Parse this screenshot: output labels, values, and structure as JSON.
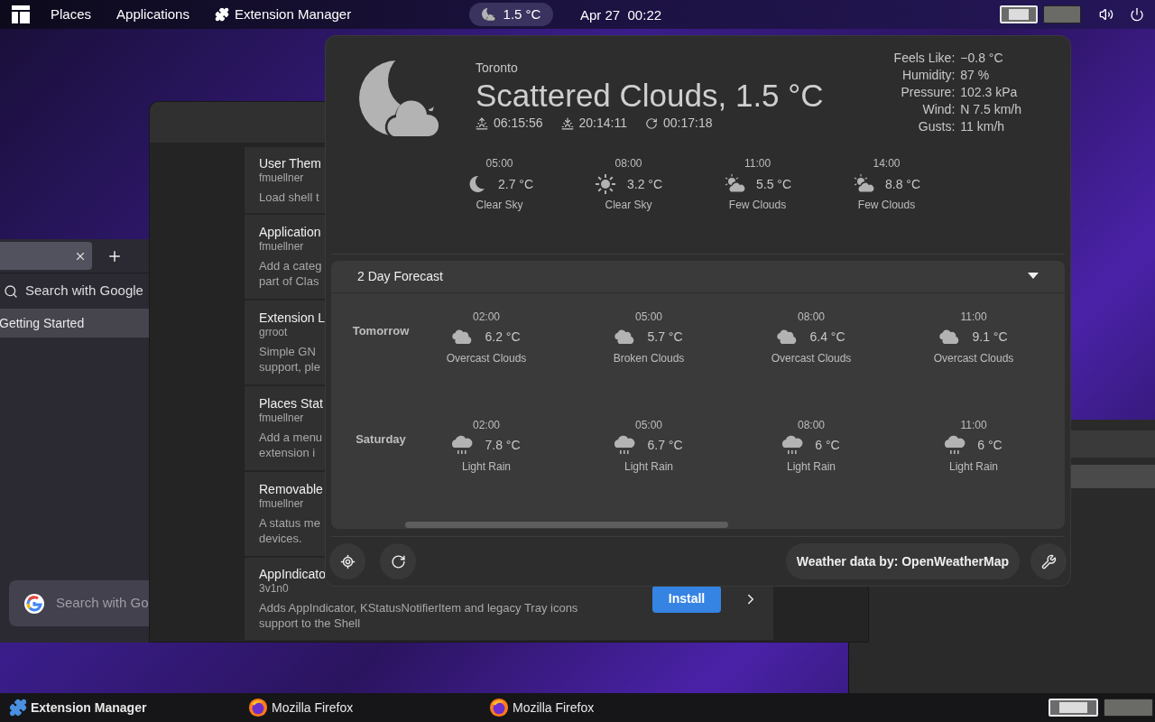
{
  "top_bar": {
    "menus": [
      "Places",
      "Applications"
    ],
    "app": "Extension Manager",
    "weather": "1.5 °C",
    "clock": "Apr 27  00:22",
    "workspaces": [
      {
        "selected": true
      },
      {
        "selected": false
      }
    ]
  },
  "firefox": {
    "search_placeholder": "Search with Google",
    "bookmark": "Getting Started",
    "page_search_placeholder": "Search with Go"
  },
  "extension_manager": {
    "extensions": [
      {
        "name": "User Them",
        "author": "fmuellner",
        "description": [
          "Load shell t"
        ]
      },
      {
        "name": "Application",
        "author": "fmuellner",
        "description": [
          "Add a categ",
          "part of Clas"
        ]
      },
      {
        "name": "Extension L",
        "author": "grroot",
        "description": [
          "Simple GN",
          "support, ple"
        ]
      },
      {
        "name": "Places Stat",
        "author": "fmuellner",
        "description": [
          "Add a menu",
          "extension i"
        ]
      },
      {
        "name": "Removable",
        "author": "fmuellner",
        "description": [
          "A status me",
          "devices."
        ]
      },
      {
        "name": "AppIndicato",
        "author": "3v1n0",
        "description": [
          "Adds AppIndicator, KStatusNotifierItem and legacy Tray icons",
          "support to the Shell"
        ],
        "action": "Install"
      }
    ]
  },
  "weather": {
    "kind": "night_clouds",
    "location": "Toronto",
    "summary": "Scattered Clouds, 1.5 °C",
    "sunrise": "06:15:56",
    "sunset": "20:14:11",
    "updated": "00:17:18",
    "details": [
      {
        "label": "Feels Like:",
        "value": "−0.8 °C"
      },
      {
        "label": "Humidity:",
        "value": "87 %"
      },
      {
        "label": "Pressure:",
        "value": "102.3 kPa"
      },
      {
        "label": "Wind:",
        "value": "N 7.5 km/h"
      },
      {
        "label": "Gusts:",
        "value": "11 km/h"
      }
    ],
    "today": [
      {
        "time": "05:00",
        "kind": "moon",
        "temp": "2.7 °C",
        "condition": "Clear Sky"
      },
      {
        "time": "08:00",
        "kind": "sun",
        "temp": "3.2 °C",
        "condition": "Clear Sky"
      },
      {
        "time": "11:00",
        "kind": "few_clouds",
        "temp": "5.5 °C",
        "condition": "Few Clouds"
      },
      {
        "time": "14:00",
        "kind": "few_clouds",
        "temp": "8.8 °C",
        "condition": "Few Clouds"
      }
    ],
    "forecast": {
      "title": "2 Day Forecast",
      "expanded": true,
      "days": [
        {
          "label": "Tomorrow",
          "hours": [
            {
              "time": "02:00",
              "kind": "overcast",
              "temp": "6.2 °C",
              "condition": "Overcast Clouds"
            },
            {
              "time": "05:00",
              "kind": "overcast",
              "temp": "5.7 °C",
              "condition": "Broken Clouds"
            },
            {
              "time": "08:00",
              "kind": "overcast",
              "temp": "6.4 °C",
              "condition": "Overcast Clouds"
            },
            {
              "time": "11:00",
              "kind": "overcast",
              "temp": "9.1 °C",
              "condition": "Overcast Clouds"
            }
          ]
        },
        {
          "label": "Saturday",
          "hours": [
            {
              "time": "02:00",
              "kind": "rain",
              "temp": "7.8 °C",
              "condition": "Light Rain"
            },
            {
              "time": "05:00",
              "kind": "rain",
              "temp": "6.7 °C",
              "condition": "Light Rain"
            },
            {
              "time": "08:00",
              "kind": "rain",
              "temp": "6 °C",
              "condition": "Light Rain"
            },
            {
              "time": "11:00",
              "kind": "rain",
              "temp": "6 °C",
              "condition": "Light Rain"
            }
          ]
        }
      ]
    },
    "attribution": "Weather data by: OpenWeatherMap"
  },
  "taskbar": {
    "items": [
      {
        "label": "Extension Manager",
        "kind": "puzzle"
      },
      {
        "label": "Mozilla Firefox",
        "kind": "browser"
      },
      {
        "label": "Mozilla Firefox",
        "kind": "browser"
      }
    ],
    "workspaces": [
      {
        "selected": true
      },
      {
        "selected": false
      }
    ]
  }
}
